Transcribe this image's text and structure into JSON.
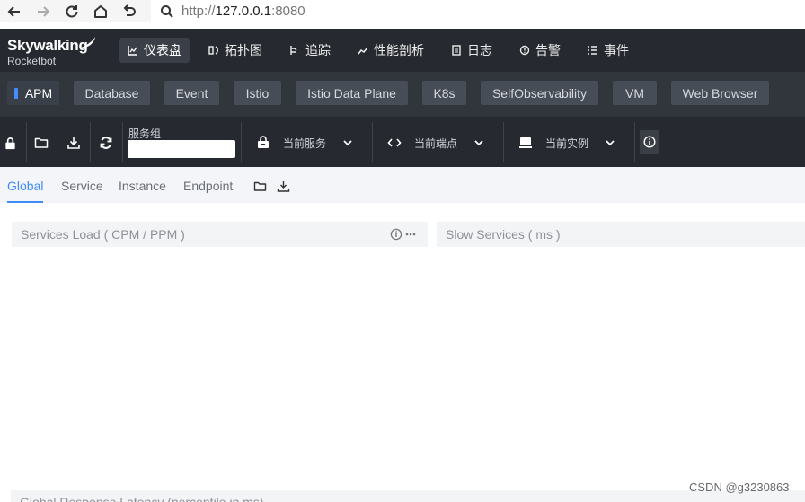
{
  "browser": {
    "url_prefix": "http://",
    "url_host": "127.0.0.1",
    "url_port": ":8080"
  },
  "header": {
    "logo_line1": "Skywalking",
    "logo_line2": "Rocketbot",
    "menu": [
      {
        "label": "仪表盘",
        "icon": "chart-icon"
      },
      {
        "label": "拓扑图",
        "icon": "topology-icon"
      },
      {
        "label": "追踪",
        "icon": "trace-icon"
      },
      {
        "label": "性能剖析",
        "icon": "profile-icon"
      },
      {
        "label": "日志",
        "icon": "log-icon"
      },
      {
        "label": "告警",
        "icon": "alarm-icon"
      },
      {
        "label": "事件",
        "icon": "event-icon"
      }
    ]
  },
  "layers": [
    "APM",
    "Database",
    "Event",
    "Istio",
    "Istio Data Plane",
    "K8s",
    "SelfObservability",
    "VM",
    "Web Browser"
  ],
  "toolbar": {
    "group_label": "服务组",
    "group_value": "",
    "service_label": "当前服务",
    "endpoint_label": "当前端点",
    "instance_label": "当前实例"
  },
  "tabs": [
    "Global",
    "Service",
    "Instance",
    "Endpoint"
  ],
  "panels": {
    "services_load": "Services Load ( CPM / PPM )",
    "slow_services": "Slow Services ( ms )",
    "bottom": "Global Response Latency (percentile in ms)"
  },
  "watermark": "CSDN @g3230863",
  "colors": {
    "accent": "#3d8bf5",
    "header_bg": "#262a30",
    "layer_bg": "#31363d"
  }
}
